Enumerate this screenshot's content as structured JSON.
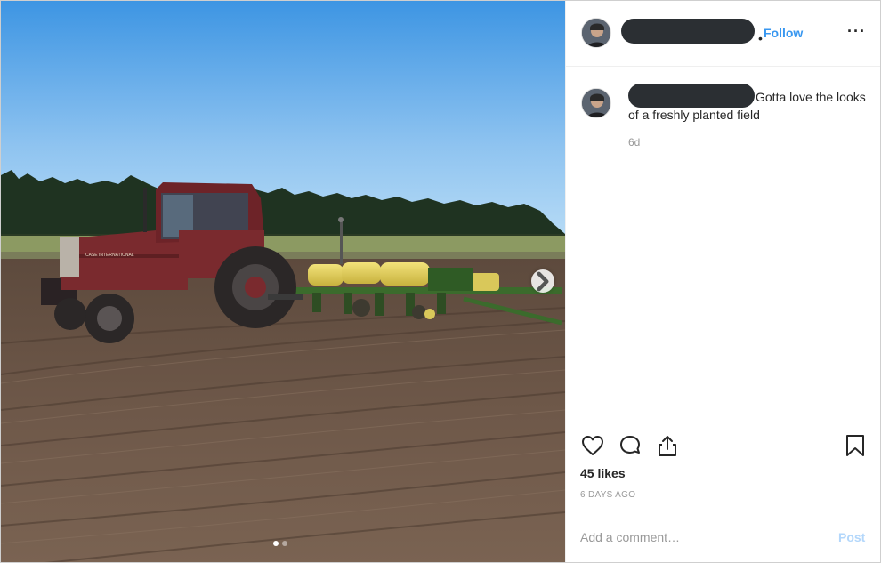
{
  "post": {
    "username_redacted": true,
    "follow_label": "Follow",
    "more_label": "···",
    "caption_text": "Gotta love the looks of a freshly planted field",
    "caption_time": "6d",
    "likes": "45 likes",
    "date": "6 DAYS AGO",
    "comment_placeholder": "Add a comment…",
    "post_label": "Post"
  },
  "photo": {
    "slide_count": 2,
    "active_slide": 1,
    "tractor_brand_text": "CASE INTERNATIONAL"
  },
  "icons": {
    "like": "heart-icon",
    "comment": "comment-bubble-icon",
    "share": "share-icon",
    "save": "bookmark-icon",
    "next": "chevron-right-icon"
  },
  "colors": {
    "link_blue": "#3897f0",
    "post_disabled": "#b3d7fb",
    "muted_text": "#999999",
    "sky": "#4a9fe6",
    "soil": "#6b5647",
    "tractor_red": "#7a2a2e"
  }
}
